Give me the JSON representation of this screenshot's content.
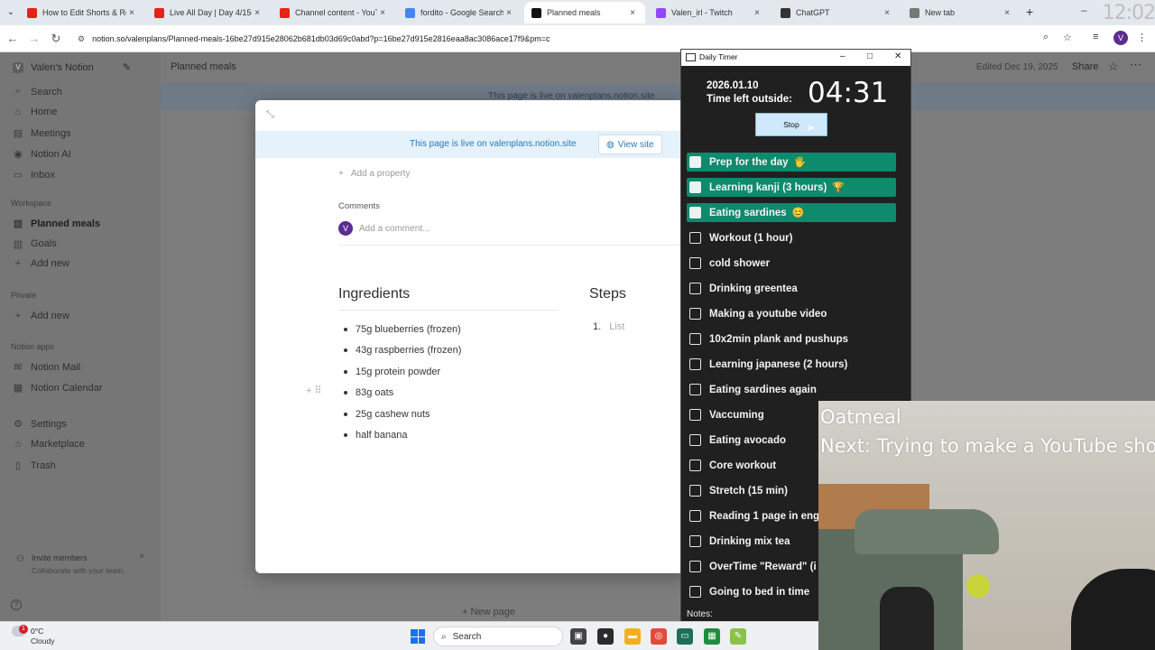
{
  "browser": {
    "tabs": [
      {
        "label": "How to Edit Shorts & Re",
        "fav": "youtube-icon",
        "color": "#e62117"
      },
      {
        "label": "Live All Day | Day 4/150 b",
        "fav": "youtube-icon",
        "color": "#e62117"
      },
      {
        "label": "Channel content - YouTub",
        "fav": "youtube-icon",
        "color": "#e62117"
      },
      {
        "label": "fordito - Google Search",
        "fav": "google-icon",
        "color": "#4285f4"
      },
      {
        "label": "Planned meals",
        "fav": "notion-icon",
        "color": "#111111"
      },
      {
        "label": "Valen_irl - Twitch",
        "fav": "twitch-icon",
        "color": "#9146ff"
      },
      {
        "label": "ChatGPT",
        "fav": "chatgpt-icon",
        "color": "#333333"
      },
      {
        "label": "New tab",
        "fav": "chrome-icon",
        "color": "#777777"
      }
    ],
    "active_tab_index": 4,
    "url": "notion.so/valenplans/Planned-meals-16be27d915e28062b681db03d69c0abd?p=16be27d915e2816eaa8ac3086ace17f9&pm=c",
    "clock_overlay": "12:02",
    "profile_initial": "V"
  },
  "notion": {
    "workspace": "Valen's Notion",
    "workspace_initial": "V",
    "sidebar_top": [
      {
        "label": "Search",
        "icon": "search-icon",
        "glyph": "⌕"
      },
      {
        "label": "Home",
        "icon": "home-icon",
        "glyph": "⌂"
      },
      {
        "label": "Meetings",
        "icon": "meetings-icon",
        "glyph": "▤"
      },
      {
        "label": "Notion AI",
        "icon": "ai-icon",
        "glyph": "◉"
      },
      {
        "label": "Inbox",
        "icon": "inbox-icon",
        "glyph": "▭"
      }
    ],
    "workspace_heading": "Workspace",
    "workspace_items": [
      {
        "label": "Planned meals",
        "icon": "page-icon",
        "glyph": "▥",
        "active": true
      },
      {
        "label": "Goals",
        "icon": "page-icon",
        "glyph": "▥",
        "active": false
      },
      {
        "label": "Add new",
        "icon": "plus-icon",
        "glyph": "+",
        "active": false
      }
    ],
    "private_heading": "Private",
    "private_add": "Add new",
    "apps_heading": "Notion apps",
    "apps": [
      {
        "label": "Notion Mail",
        "icon": "mail-icon",
        "glyph": "✉"
      },
      {
        "label": "Notion Calendar",
        "icon": "calendar-icon",
        "glyph": "▦"
      }
    ],
    "bottom_items": [
      {
        "label": "Settings",
        "icon": "gear-icon",
        "glyph": "⚙"
      },
      {
        "label": "Marketplace",
        "icon": "marketplace-icon",
        "glyph": "⌂"
      },
      {
        "label": "Trash",
        "icon": "trash-icon",
        "glyph": "▯"
      }
    ],
    "invite_title": "Invite members",
    "invite_sub": "Collaborate with your team.",
    "breadcrumb": "Planned meals",
    "edited": "Edited Dec 19, 2025",
    "share": "Share",
    "bg_banner": "This page is live on valenplans.notion.site",
    "new_page": "New page"
  },
  "modal": {
    "live_banner": "This page is live on valenplans.notion.site",
    "view_site": "View site",
    "add_property": "Add a property",
    "comments_heading": "Comments",
    "comment_placeholder": "Add a comment...",
    "comment_avatar": "V",
    "ingredients_heading": "Ingredients",
    "ingredients": [
      "75g blueberries (frozen)",
      "43g raspberries (frozen)",
      "15g protein powder",
      "83g oats",
      "25g cashew nuts",
      "half banana"
    ],
    "steps_heading": "Steps",
    "steps_num": "1.",
    "steps_placeholder": "List"
  },
  "timer": {
    "window_title": "Daily Timer",
    "date": "2026.01.10",
    "time_left_label": "Time left outside:",
    "countdown": "04:31",
    "stop_label": "Stop",
    "tasks": [
      {
        "label": "Prep for the day",
        "done": true,
        "emoji": "🖐"
      },
      {
        "label": "Learning kanji (3 hours)",
        "done": true,
        "emoji": "🏆"
      },
      {
        "label": "Eating sardines",
        "done": true,
        "emoji": "😊"
      },
      {
        "label": "Workout (1 hour)",
        "done": false,
        "emoji": ""
      },
      {
        "label": "cold shower",
        "done": false,
        "emoji": ""
      },
      {
        "label": "Drinking greentea",
        "done": false,
        "emoji": ""
      },
      {
        "label": "Making a youtube video",
        "done": false,
        "emoji": ""
      },
      {
        "label": "10x2min plank and pushups",
        "done": false,
        "emoji": ""
      },
      {
        "label": "Learning japanese (2 hours)",
        "done": false,
        "emoji": ""
      },
      {
        "label": "Eating sardines again",
        "done": false,
        "emoji": ""
      },
      {
        "label": "Vaccuming",
        "done": false,
        "emoji": ""
      },
      {
        "label": "Eating avocado",
        "done": false,
        "emoji": ""
      },
      {
        "label": "Core workout",
        "done": false,
        "emoji": ""
      },
      {
        "label": "Stretch (15 min)",
        "done": false,
        "emoji": ""
      },
      {
        "label": "Reading 1 page in eng",
        "done": false,
        "emoji": ""
      },
      {
        "label": "Drinking mix tea",
        "done": false,
        "emoji": ""
      },
      {
        "label": "OverTime \"Reward\" (i",
        "done": false,
        "emoji": ""
      },
      {
        "label": "Going to bed in time",
        "done": false,
        "emoji": ""
      }
    ],
    "notes_label": "Notes:"
  },
  "stream_overlay": {
    "current": "Oatmeal",
    "next": "Next: Trying to make a YouTube sho"
  },
  "taskbar": {
    "weather_badge": "1",
    "temp": "0°C",
    "condition": "Cloudy",
    "search": "Search",
    "apps": [
      {
        "name": "task-view-icon",
        "glyph": "▣",
        "color": "#444444"
      },
      {
        "name": "obs-icon",
        "glyph": "●",
        "color": "#2b2b2b"
      },
      {
        "name": "file-explorer-icon",
        "glyph": "▬",
        "color": "#f2b01e"
      },
      {
        "name": "chrome-icon",
        "glyph": "◎",
        "color": "#e14b3b"
      },
      {
        "name": "timer-app-icon",
        "glyph": "▭",
        "color": "#1d6f5a"
      },
      {
        "name": "spreadsheet-icon",
        "glyph": "▦",
        "color": "#1e8e3e"
      },
      {
        "name": "notepad-icon",
        "glyph": "✎",
        "color": "#8bc34a"
      }
    ]
  }
}
